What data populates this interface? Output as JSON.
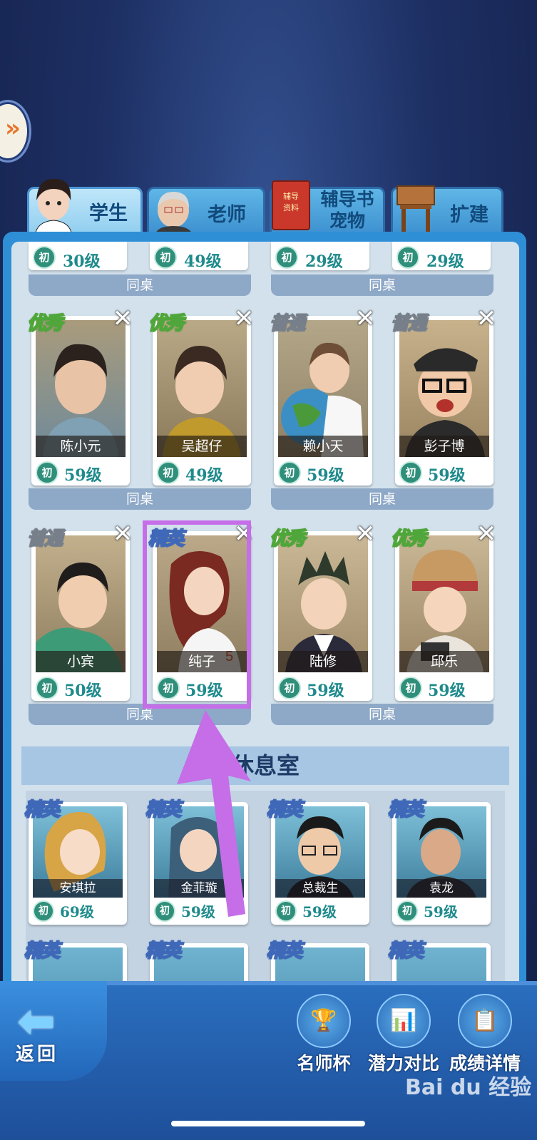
{
  "tabs": [
    {
      "label": "学生",
      "active": true
    },
    {
      "label": "老师",
      "active": false
    },
    {
      "label": "辅导书\n宠物",
      "book_text": "辅导\n资料",
      "active": false
    },
    {
      "label": "扩建",
      "active": false
    }
  ],
  "side_toggle": {
    "icon": "double-chevron-right-icon",
    "glyph": "»"
  },
  "top_partial_row": {
    "levels": [
      "30级",
      "49级",
      "29级",
      "29级"
    ],
    "badge": "初",
    "desk_labels": [
      "同桌",
      "同桌"
    ]
  },
  "students": [
    {
      "rank": "优秀",
      "rank_color": "green",
      "name": "陈小元",
      "badge": "初",
      "level": "59级"
    },
    {
      "rank": "优秀",
      "rank_color": "green",
      "name": "吴超仔",
      "badge": "初",
      "level": "49级"
    },
    {
      "rank": "普通",
      "rank_color": "gray",
      "name": "赖小天",
      "badge": "初",
      "level": "59级"
    },
    {
      "rank": "普通",
      "rank_color": "gray",
      "name": "彭子博",
      "badge": "初",
      "level": "59级"
    },
    {
      "rank": "普通",
      "rank_color": "gray",
      "name": "小宾",
      "badge": "初",
      "level": "50级"
    },
    {
      "rank": "精英",
      "rank_color": "blue",
      "name": "纯子",
      "badge": "初",
      "level": "59级"
    },
    {
      "rank": "优秀",
      "rank_color": "green",
      "name": "陆修",
      "badge": "初",
      "level": "59级"
    },
    {
      "rank": "优秀",
      "rank_color": "green",
      "name": "邱乐",
      "badge": "初",
      "level": "59级"
    }
  ],
  "desk_label": "同桌",
  "close_glyph": "✕",
  "lounge": {
    "title": "休息室",
    "cards": [
      {
        "rank": "精英",
        "name": "安琪拉",
        "badge": "初",
        "level": "69级"
      },
      {
        "rank": "精英",
        "name": "金菲璇",
        "badge": "初",
        "level": "59级"
      },
      {
        "rank": "精英",
        "name": "总裁生",
        "badge": "初",
        "level": "59级"
      },
      {
        "rank": "精英",
        "name": "袁龙",
        "badge": "初",
        "level": "59级"
      }
    ],
    "next_row_ranks": [
      "精英",
      "精英",
      "精英",
      "精英"
    ]
  },
  "bottom": {
    "back_label": "返回",
    "back_icon": "back-arrow-icon",
    "actions": [
      {
        "label": "名师杯",
        "icon": "trophy-icon",
        "glyph": "🏆"
      },
      {
        "label": "潜力对比",
        "icon": "bar-chart-icon",
        "glyph": "📊"
      },
      {
        "label": "成绩详情",
        "icon": "clipboard-icon",
        "glyph": "📋"
      }
    ]
  },
  "watermark": "Bai du 经验",
  "colors": {
    "accent_highlight": "#c56ee8",
    "panel_blue": "#2e8fd6",
    "level_text": "#1f8a8c"
  }
}
